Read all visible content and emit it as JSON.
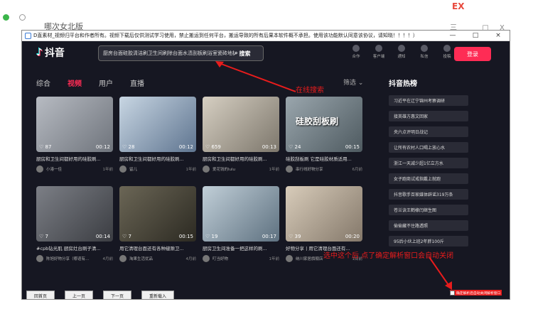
{
  "background": {
    "title": "哪次女北版",
    "ex_label": "EX",
    "right_controls": "三 _ □ X"
  },
  "window": {
    "title": "D直素材_视频归平台和作者所有。视频下载后仅供测试学习使用，禁止搬运到任何平台，搬运导致的所有后果本软件概不承担。使用该功能默认同意该协议，请知晓！！！！）",
    "min": "—",
    "max": "□",
    "close": "×"
  },
  "header": {
    "logo_text": "抖音",
    "search_query": "厨房台面硅胶清洁刷卫生间刷除台面水渍刮板刷浴室瓷砖地板刷",
    "search_button": "搜索",
    "icons": [
      {
        "name": "cooperate-icon",
        "label": "合作"
      },
      {
        "name": "client-icon",
        "label": "客户端"
      },
      {
        "name": "notification-icon",
        "label": "通知"
      },
      {
        "name": "message-icon",
        "label": "私信"
      },
      {
        "name": "upload-icon",
        "label": "投稿"
      }
    ],
    "login": "登录"
  },
  "tabs": [
    {
      "label": "综合",
      "active": false
    },
    {
      "label": "视频",
      "active": true
    },
    {
      "label": "用户",
      "active": false
    },
    {
      "label": "直播",
      "active": false
    }
  ],
  "filter": "筛选 ⌄",
  "annotation_search": "在线搜索",
  "videos": [
    {
      "likes": "♡ 87",
      "duration": "00:12",
      "title": "厨房和卫生间都好用的硅胶刷...",
      "author": "小港一佳",
      "time": "1年前",
      "color": "#8a8f98"
    },
    {
      "likes": "♡ 28",
      "duration": "00:12",
      "title": "厨房和卫生间都好用的硅胶刷...",
      "author": "留儿",
      "time": "1年前",
      "color": "#7a8fa8"
    },
    {
      "likes": "♡ 659",
      "duration": "00:13",
      "title": "厨房和卫生间都好用的硅胶刷...",
      "author": "爱花钱的lulu",
      "time": "1年前",
      "color": "#9a9488"
    },
    {
      "likes": "♡ 24",
      "duration": "00:15",
      "title": "硅胶刮板刷 它是硅胶材质适用...",
      "author": "串行线好物分享",
      "time": "6月前",
      "color": "#6e7a82"
    },
    {
      "likes": "♡ 7",
      "duration": "00:14",
      "title": "#cpb钻光肌 厨房灶台刷子清...",
      "author": "陈旭好物分享（哪谊有...",
      "time": "4月前",
      "color": "#5c5f66"
    },
    {
      "likes": "♡ 7",
      "duration": "00:15",
      "title": "用它清理台面还有各种缝隙卫...",
      "author": "淘果生活优品",
      "time": "4月前",
      "color": "#4d4a40"
    },
    {
      "likes": "♡ 19",
      "duration": "00:17",
      "title": "厨房卫生间准备一把这样的刷...",
      "author": "叮当好物",
      "time": "1年前",
      "color": "#8fa0ad"
    },
    {
      "likes": "♡ 39",
      "duration": "00:20",
      "title": "好物分享 | 用它清理台面还有...",
      "author": "纳川家居旗舰店",
      "time": "1周前",
      "color": "#a89c8a"
    }
  ],
  "thumb_overlay_text": "硅胶刮板刷",
  "hot": {
    "title": "抖音热榜",
    "items": [
      "习近平在辽宁锦州考察调研",
      "接英雄方惠文回家",
      "央六点评明日战记",
      "让所有农村人口喝上放心水",
      "浙江一天减少超1亿立方水",
      "女子跑商试戒指戴上就跑",
      "抖音歌手百家媒体辟谣319万条",
      "苍兰诀王鹤棣闫继生图",
      "偷偷藏不住路透照",
      "95后小伙上班2年胖100斤"
    ]
  },
  "bottom_buttons": [
    "回首页",
    "上一页",
    "下一页",
    "重新载入"
  ],
  "annotation_bottom": "选中这个后  点了确定解析窗口会自动关闭",
  "checkbox_label": "确定解析后自动关闭解析窗口"
}
